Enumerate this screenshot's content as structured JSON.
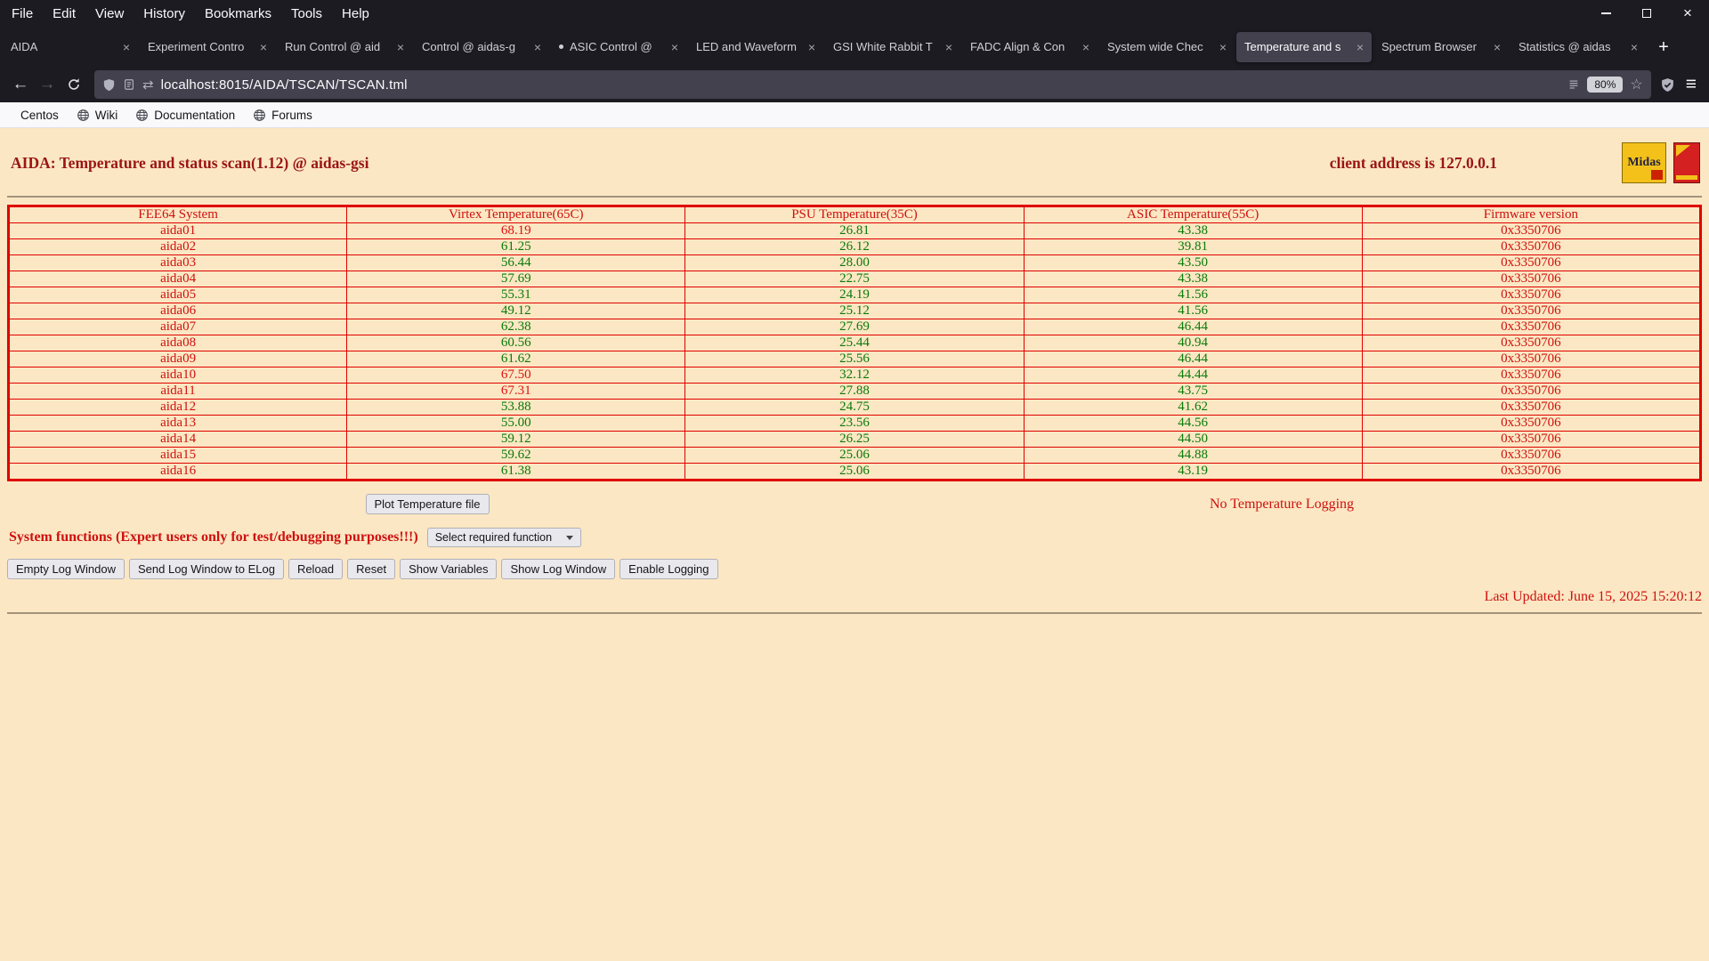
{
  "colors": {
    "page_bg": "#fbe7c3",
    "title_red": "#9b1515",
    "text_red": "#cf1010",
    "border_red": "#e00000",
    "ok_green": "#0a7a0a",
    "alarm_red": "#e01010"
  },
  "menu": {
    "items": [
      "File",
      "Edit",
      "View",
      "History",
      "Bookmarks",
      "Tools",
      "Help"
    ]
  },
  "tabs": [
    {
      "label": "AIDA"
    },
    {
      "label": "Experiment Contro"
    },
    {
      "label": "Run Control @ aid"
    },
    {
      "label": "Control @ aidas-g"
    },
    {
      "label": "ASIC Control @",
      "dot": true
    },
    {
      "label": "LED and Waveform"
    },
    {
      "label": "GSI White Rabbit T"
    },
    {
      "label": "FADC Align & Con"
    },
    {
      "label": "System wide Chec"
    },
    {
      "label": "Temperature and s",
      "active": true
    },
    {
      "label": "Spectrum Browser"
    },
    {
      "label": "Statistics @ aidas"
    }
  ],
  "navbar": {
    "url": "localhost:8015/AIDA/TSCAN/TSCAN.tml",
    "zoom": "80%"
  },
  "bookmarks": [
    {
      "label": "Centos",
      "icon": "centos-logo"
    },
    {
      "label": "Wiki",
      "icon": "globe"
    },
    {
      "label": "Documentation",
      "icon": "globe"
    },
    {
      "label": "Forums",
      "icon": "globe"
    }
  ],
  "page": {
    "title": "AIDA: Temperature and status scan(1.12) @ aidas-gsi",
    "client_address": "client address is 127.0.0.1",
    "midas_logo_text": "Midas",
    "table": {
      "headers": [
        "FEE64 System",
        "Virtex Temperature(65C)",
        "PSU Temperature(35C)",
        "ASIC Temperature(55C)",
        "Firmware version"
      ],
      "rows": [
        {
          "name": "aida01",
          "virtex": "68.19",
          "virtex_alarm": true,
          "psu": "26.81",
          "asic": "43.38",
          "firmware": "0x3350706"
        },
        {
          "name": "aida02",
          "virtex": "61.25",
          "psu": "26.12",
          "asic": "39.81",
          "firmware": "0x3350706"
        },
        {
          "name": "aida03",
          "virtex": "56.44",
          "psu": "28.00",
          "asic": "43.50",
          "firmware": "0x3350706"
        },
        {
          "name": "aida04",
          "virtex": "57.69",
          "psu": "22.75",
          "asic": "43.38",
          "firmware": "0x3350706"
        },
        {
          "name": "aida05",
          "virtex": "55.31",
          "psu": "24.19",
          "asic": "41.56",
          "firmware": "0x3350706"
        },
        {
          "name": "aida06",
          "virtex": "49.12",
          "psu": "25.12",
          "asic": "41.56",
          "firmware": "0x3350706"
        },
        {
          "name": "aida07",
          "virtex": "62.38",
          "psu": "27.69",
          "asic": "46.44",
          "firmware": "0x3350706"
        },
        {
          "name": "aida08",
          "virtex": "60.56",
          "psu": "25.44",
          "asic": "40.94",
          "firmware": "0x3350706"
        },
        {
          "name": "aida09",
          "virtex": "61.62",
          "psu": "25.56",
          "asic": "46.44",
          "firmware": "0x3350706"
        },
        {
          "name": "aida10",
          "virtex": "67.50",
          "virtex_alarm": true,
          "psu": "32.12",
          "asic": "44.44",
          "firmware": "0x3350706"
        },
        {
          "name": "aida11",
          "virtex": "67.31",
          "virtex_alarm": true,
          "psu": "27.88",
          "asic": "43.75",
          "firmware": "0x3350706"
        },
        {
          "name": "aida12",
          "virtex": "53.88",
          "psu": "24.75",
          "asic": "41.62",
          "firmware": "0x3350706"
        },
        {
          "name": "aida13",
          "virtex": "55.00",
          "psu": "23.56",
          "asic": "44.56",
          "firmware": "0x3350706"
        },
        {
          "name": "aida14",
          "virtex": "59.12",
          "psu": "26.25",
          "asic": "44.50",
          "firmware": "0x3350706"
        },
        {
          "name": "aida15",
          "virtex": "59.62",
          "psu": "25.06",
          "asic": "44.88",
          "firmware": "0x3350706"
        },
        {
          "name": "aida16",
          "virtex": "61.38",
          "psu": "25.06",
          "asic": "43.19",
          "firmware": "0x3350706"
        }
      ]
    },
    "plot_button": "Plot Temperature file",
    "logging_status": "No Temperature Logging",
    "system_functions_label": "System functions (Expert users only for test/debugging purposes!!!)",
    "function_select_value": "Select required function",
    "action_buttons": [
      "Empty Log Window",
      "Send Log Window to ELog",
      "Reload",
      "Reset",
      "Show Variables",
      "Show Log Window",
      "Enable Logging"
    ],
    "last_updated": "Last Updated: June 15, 2025 15:20:12"
  }
}
